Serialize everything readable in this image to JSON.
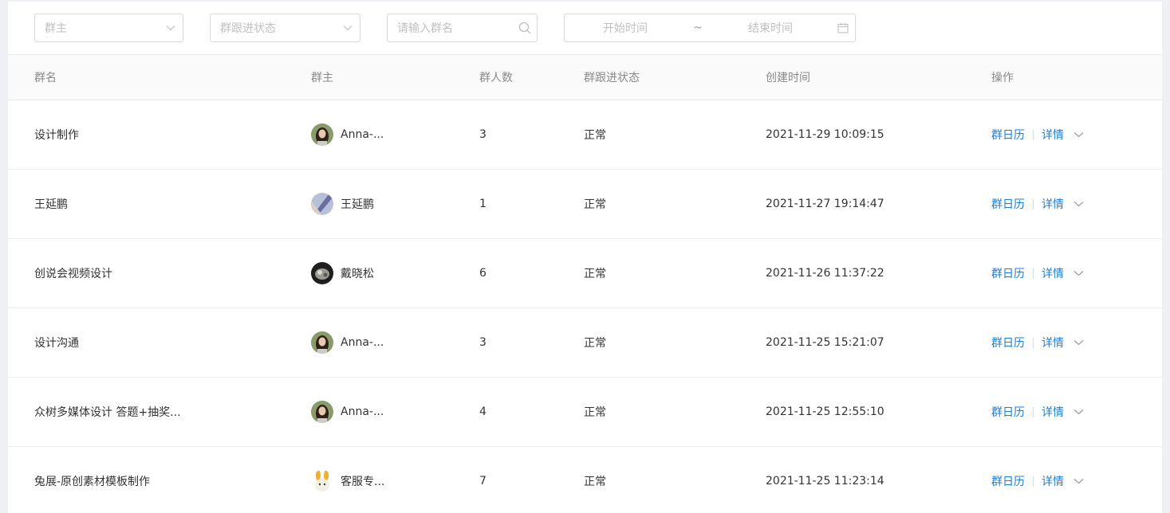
{
  "filters": {
    "owner_placeholder": "群主",
    "status_placeholder": "群跟进状态",
    "search_placeholder": "请输入群名",
    "start_placeholder": "开始时间",
    "range_separator": "~",
    "end_placeholder": "结束时间"
  },
  "table": {
    "headers": {
      "name": "群名",
      "owner": "群主",
      "count": "群人数",
      "status": "群跟进状态",
      "time": "创建时间",
      "ops": "操作"
    },
    "actions": {
      "calendar": "群日历",
      "detail": "详情"
    },
    "rows": [
      {
        "name": "设计制作",
        "owner": "Anna-...",
        "count": "3",
        "status": "正常",
        "time": "2021-11-29 10:09:15"
      },
      {
        "name": "王延鹏",
        "owner": "王延鹏",
        "count": "1",
        "status": "正常",
        "time": "2021-11-27 19:14:47"
      },
      {
        "name": "创说会视频设计",
        "owner": "戴晓松",
        "count": "6",
        "status": "正常",
        "time": "2021-11-26 11:37:22"
      },
      {
        "name": "设计沟通",
        "owner": "Anna-...",
        "count": "3",
        "status": "正常",
        "time": "2021-11-25 15:21:07"
      },
      {
        "name": "众树多媒体设计 答题+抽奖...",
        "owner": "Anna-...",
        "count": "4",
        "status": "正常",
        "time": "2021-11-25 12:55:10"
      },
      {
        "name": "兔展-原创素材模板制作",
        "owner": "客服专...",
        "count": "7",
        "status": "正常",
        "time": "2021-11-25 11:23:14"
      }
    ]
  },
  "colors": {
    "link": "#1a7fd6",
    "header_bg": "#fafafa",
    "page_bg": "#eef0f5"
  },
  "icons": {
    "select_arrow": "chevron-down-icon",
    "search": "search-icon",
    "date": "calendar-icon",
    "row_more": "chevron-down-icon"
  }
}
